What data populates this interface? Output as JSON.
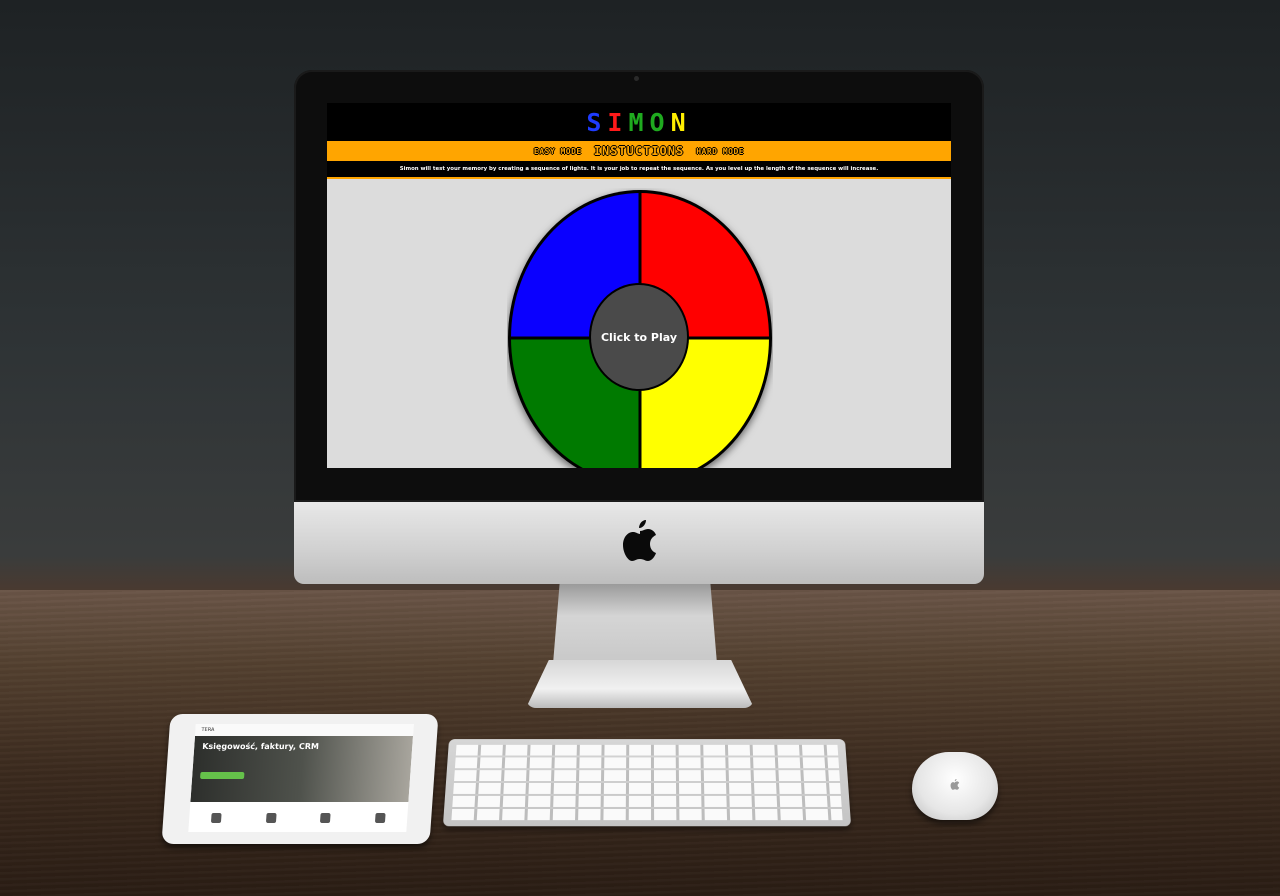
{
  "game": {
    "title_letters": [
      {
        "char": "S",
        "color": "#1f3cff"
      },
      {
        "char": "I",
        "color": "#ff1a1a"
      },
      {
        "char": "M",
        "color": "#1faa1f"
      },
      {
        "char": "O",
        "color": "#1faa1f"
      },
      {
        "char": "N",
        "color": "#ffee00"
      }
    ],
    "nav": {
      "easy": "EASY MODE",
      "instructions": "INSTUCTIONS",
      "hard": "HARD MODE"
    },
    "description": "Simon will test your memory by creating a sequence of lights. It is your job to repeat the sequence. As you level up the length of the sequence will increase.",
    "center_label": "Click to Play",
    "colors": {
      "blue": "#0a00ff",
      "red": "#ff0000",
      "green": "#007a00",
      "yellow": "#ffff00",
      "accent": "#ffa500",
      "center": "#4a4a4a"
    }
  },
  "ipad": {
    "brand": "TERA",
    "headline": "Księgowość, faktury, CRM"
  },
  "icons": {
    "apple": "apple-logo-icon",
    "mouse": "apple-logo-icon"
  }
}
